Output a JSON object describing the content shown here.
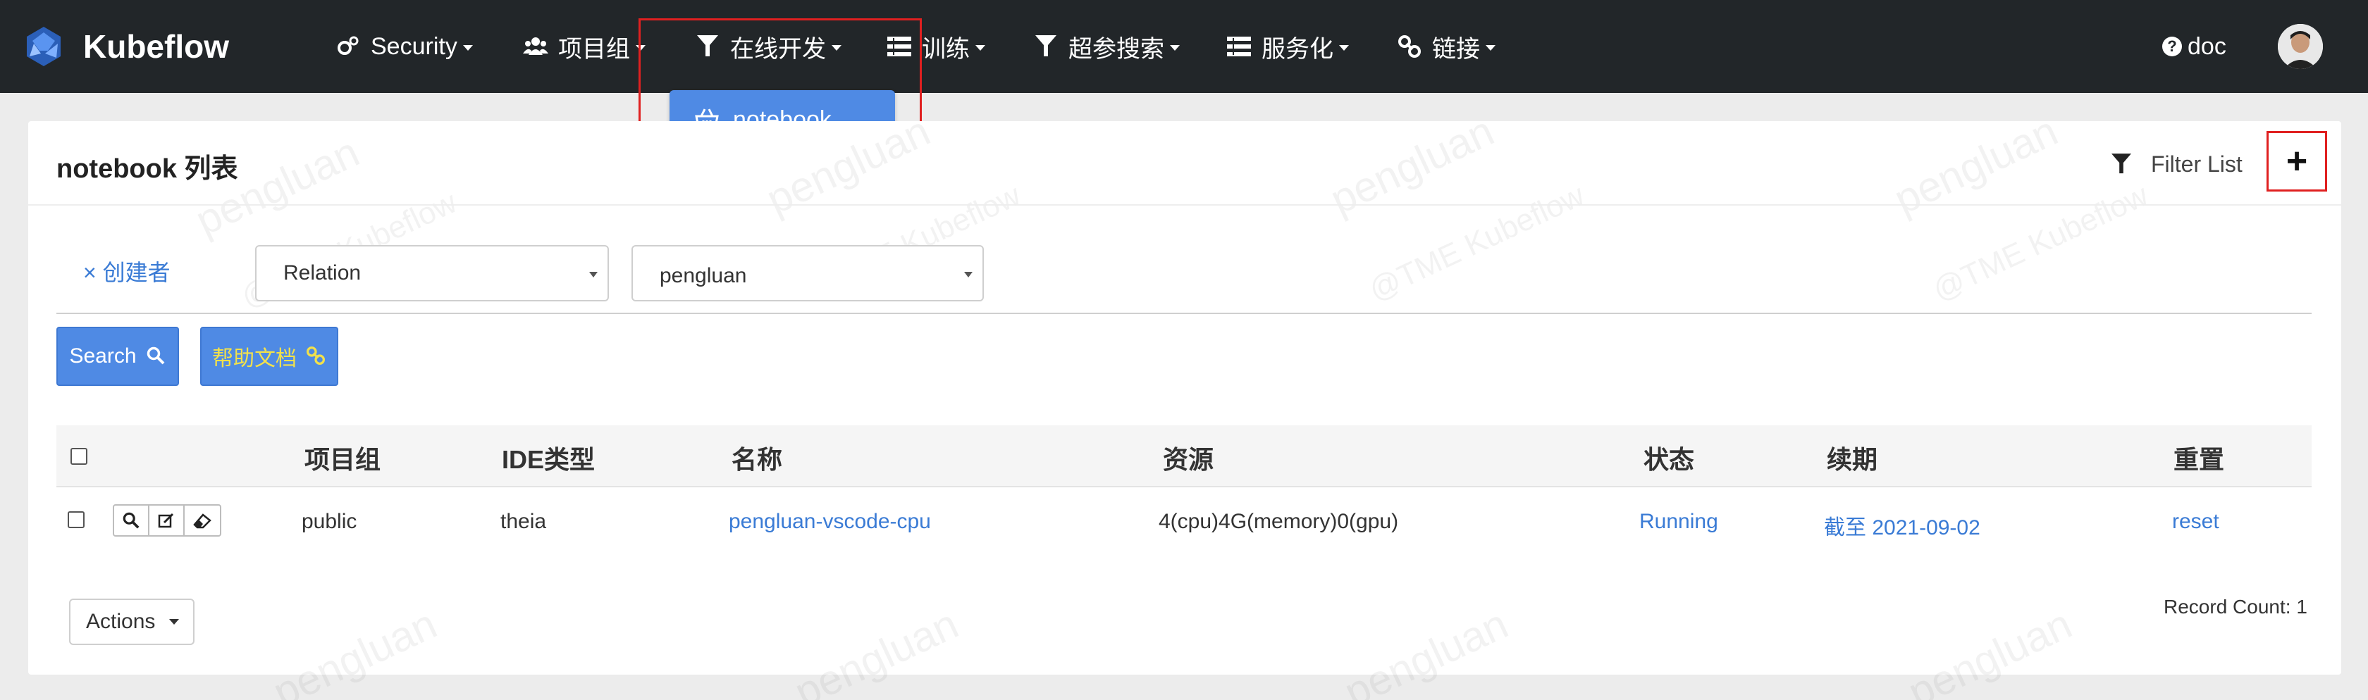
{
  "brand": {
    "name": "Kubeflow"
  },
  "nav": {
    "items": [
      {
        "label": "Security",
        "icon": "cogs-icon"
      },
      {
        "label": "项目组",
        "icon": "users-icon"
      },
      {
        "label": "在线开发",
        "icon": "filter-icon"
      },
      {
        "label": "训练",
        "icon": "list-icon"
      },
      {
        "label": "超参搜索",
        "icon": "filter-icon"
      },
      {
        "label": "服务化",
        "icon": "list-icon"
      },
      {
        "label": "链接",
        "icon": "link-icon"
      }
    ],
    "doc_label": "doc",
    "dropdown": {
      "item_label": "notebook",
      "icon": "basket-icon"
    }
  },
  "panel": {
    "title": "notebook 列表",
    "filter_list_label": "Filter List",
    "add_label": "+"
  },
  "filters": {
    "remove_label": "× 创建者",
    "relation_value": "Relation",
    "value": "pengluan"
  },
  "buttons": {
    "search_label": "Search",
    "help_label": "帮助文档"
  },
  "table": {
    "columns": [
      "项目组",
      "IDE类型",
      "名称",
      "资源",
      "状态",
      "续期",
      "重置"
    ],
    "rows": [
      {
        "project": "public",
        "ide_type": "theia",
        "name": "pengluan-vscode-cpu",
        "resource": "4(cpu)4G(memory)0(gpu)",
        "status": "Running",
        "renew": "截至 2021-09-02",
        "reset": "reset"
      }
    ]
  },
  "footer": {
    "actions_label": "Actions",
    "record_count": "Record Count: 1"
  },
  "watermark": {
    "user": "pengluan",
    "product": "@TME Kubeflow"
  },
  "colors": {
    "navbar": "#222629",
    "primary": "#4f8ae4",
    "link": "#3a7bd5",
    "highlight": "#e02020",
    "help_text": "#f2e14b"
  }
}
